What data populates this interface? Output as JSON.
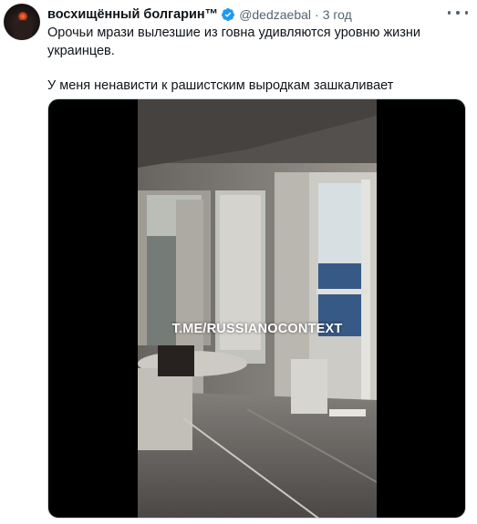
{
  "tweet": {
    "display_name": "восхищённый болгарин™",
    "handle": "@dedzaebal",
    "separator": "·",
    "time": "3 год",
    "text_line1": "Орочьи мрази вылезшие из говна удивляются уровню жизни украинцев.",
    "text_line2": "У меня ненависти к рашистским выродкам зашкаливает",
    "icons": {
      "verified": "verified-badge-icon",
      "more": "more-dots-icon"
    },
    "colors": {
      "verified": "#1d9bf0",
      "secondary_text": "#536471"
    }
  },
  "media": {
    "watermark": "T.ME/RUSSIANOCONTEXT"
  }
}
